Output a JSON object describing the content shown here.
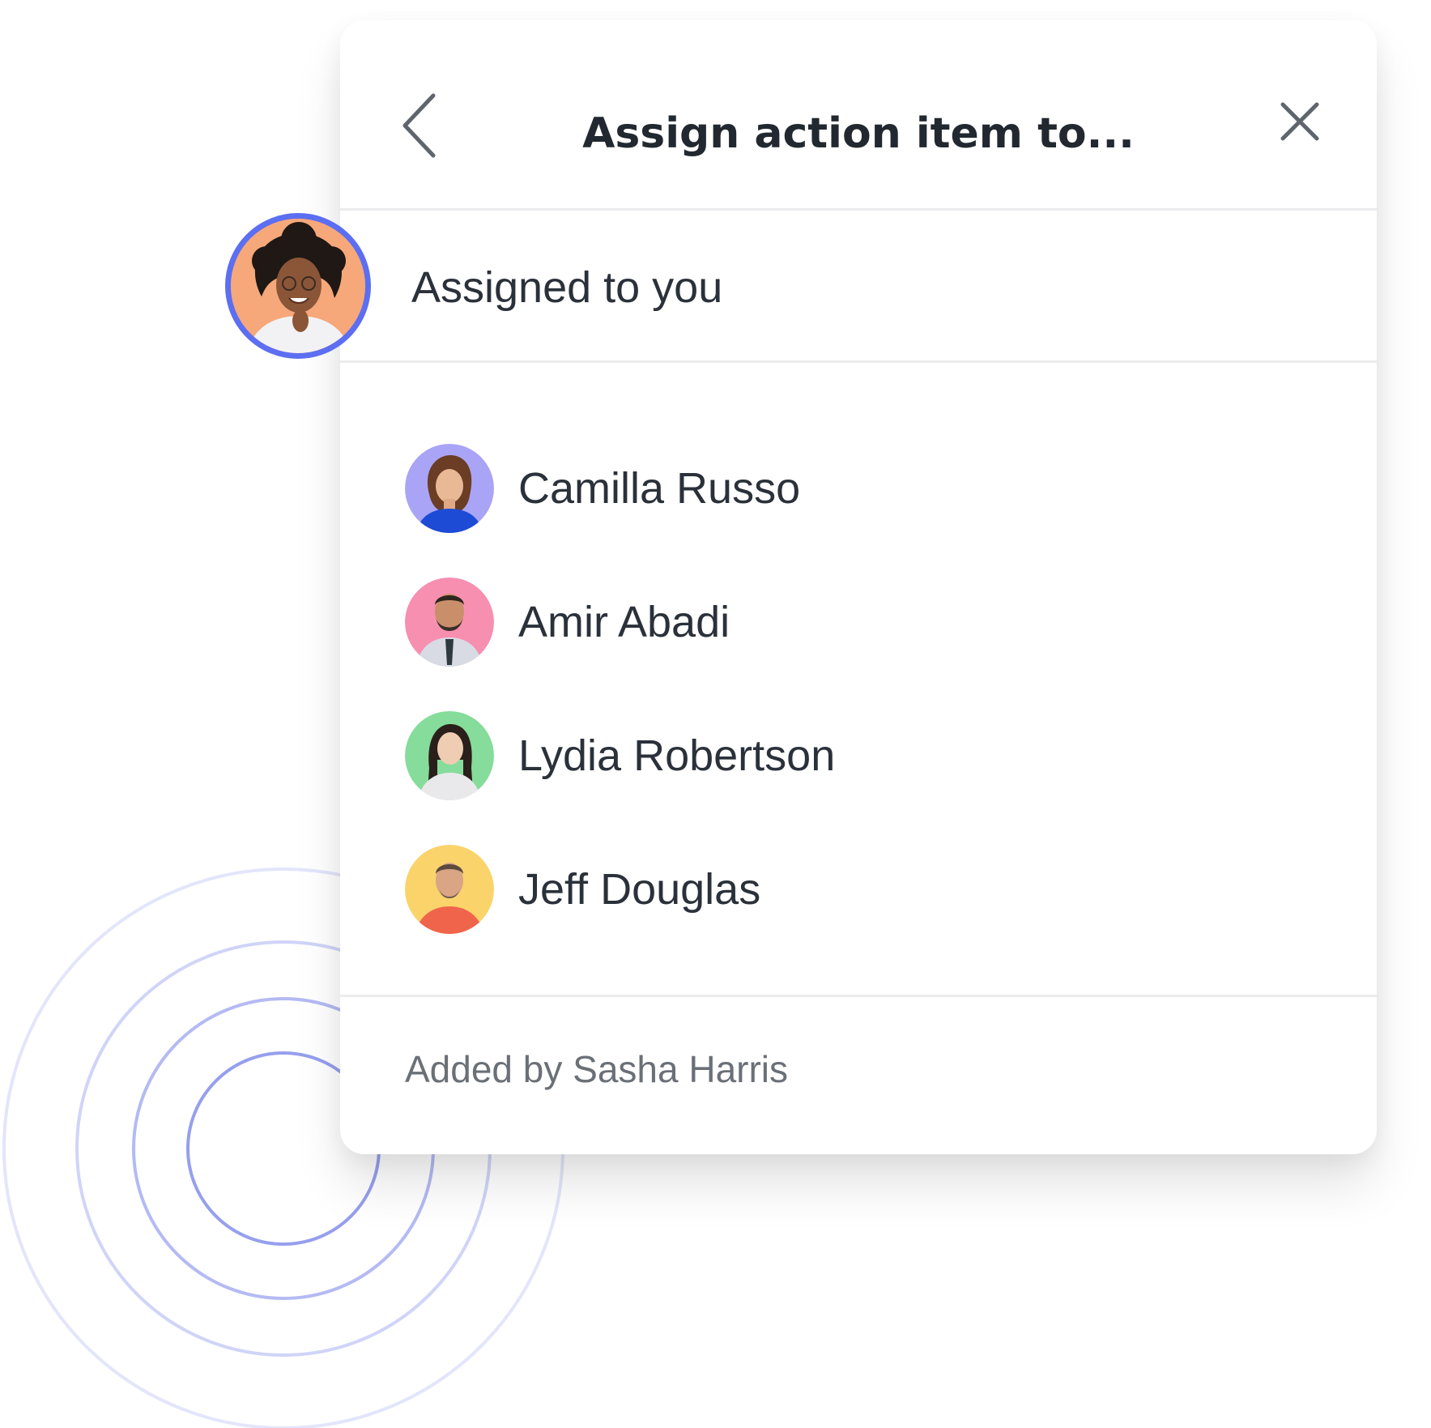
{
  "dialog": {
    "title": "Assign action item to...",
    "back_icon": "chevron-left-icon",
    "close_icon": "close-icon"
  },
  "assigned_to_you": {
    "label": "Assigned to you",
    "avatar_ring_color": "#5c6ef2",
    "avatar_bg_color": "#f6a87a"
  },
  "people": [
    {
      "name": "Camilla Russo",
      "avatar_bg": "#a9a4f5"
    },
    {
      "name": "Amir Abadi",
      "avatar_bg": "#f78fb0"
    },
    {
      "name": "Lydia Robertson",
      "avatar_bg": "#86dc9a"
    },
    {
      "name": "Jeff Douglas",
      "avatar_bg": "#fad36a"
    }
  ],
  "footer": {
    "added_by": "Added by Sasha Harris"
  },
  "colors": {
    "title_text": "#22282f",
    "body_text": "#2b313a",
    "muted_text": "#6b7077",
    "divider": "#ebeced",
    "ring": "#7b84ec"
  }
}
